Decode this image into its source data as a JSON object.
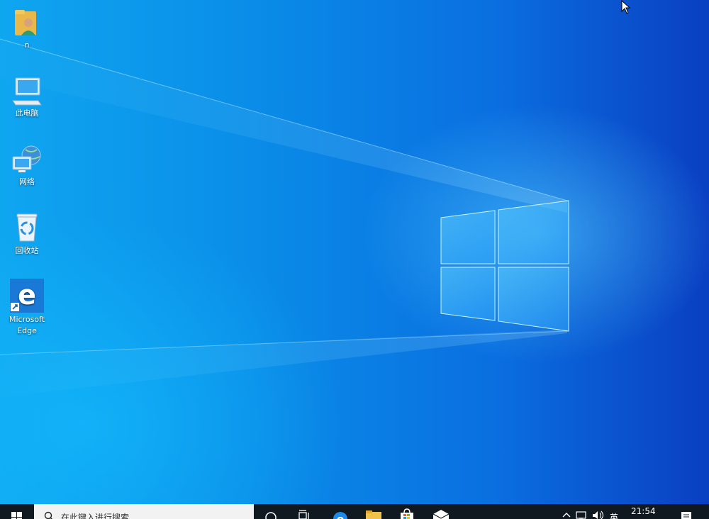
{
  "desktop": {
    "icons": [
      {
        "label": "n",
        "icon": "user-folder-icon"
      },
      {
        "label": "此电脑",
        "icon": "computer-icon"
      },
      {
        "label": "网络",
        "icon": "network-icon"
      },
      {
        "label": "回收站",
        "icon": "recycle-bin-icon"
      },
      {
        "label": "Microsoft Edge",
        "icon": "edge-icon"
      }
    ]
  },
  "taskbar": {
    "search_placeholder": "在此键入进行搜索",
    "pinned": [
      "cortana-icon",
      "task-view-icon",
      "edge-icon",
      "file-explorer-icon",
      "store-icon",
      "mail-icon"
    ],
    "tray": {
      "language": "英",
      "time": "21:54"
    }
  },
  "colors": {
    "taskbar": "#101820",
    "wallpaper_accent": "#0a63d6"
  }
}
